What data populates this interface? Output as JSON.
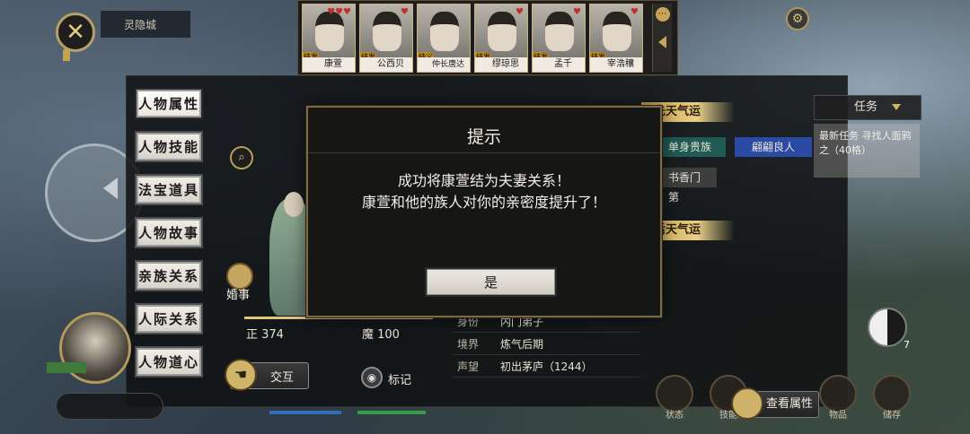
{
  "location": "灵隐城",
  "characters": [
    {
      "name": "康萱",
      "badge": "结发",
      "hearts": "♥♥♥"
    },
    {
      "name": "公西贝",
      "badge": "结发",
      "hearts": "♥"
    },
    {
      "name": "仲长唐达",
      "badge": "结义",
      "hearts": ""
    },
    {
      "name": "缪琼思",
      "badge": "结发",
      "hearts": "♥"
    },
    {
      "name": "孟千",
      "badge": "结发",
      "hearts": "♥"
    },
    {
      "name": "宰浩穰",
      "badge": "结发",
      "hearts": "♥"
    }
  ],
  "side_tabs": [
    "人物属性",
    "人物技能",
    "法宝道具",
    "人物故事",
    "亲族关系",
    "人际关系",
    "人物道心"
  ],
  "left": {
    "marriage_label": "婚事",
    "zheng_label": "正 374",
    "mo_label": "魔 100",
    "interact_label": "交互",
    "mark_label": "标记"
  },
  "info_rows": [
    {
      "key": "身份",
      "value": "内门弟子"
    },
    {
      "key": "境界",
      "value": "炼气后期"
    },
    {
      "key": "声望",
      "value": "初出茅庐（1244）"
    }
  ],
  "fortune": {
    "innate_title": "先天气运",
    "later_title": "后天气运",
    "tags": {
      "noble": "单身贵族",
      "good": "翩翩良人",
      "scholar": "书香门第"
    }
  },
  "task": {
    "header": "任务",
    "text": "最新任务 寻找人面鸦之（40格）"
  },
  "bottom": {
    "view_attr_label": "查看属性",
    "taiji_count": "7",
    "labels": [
      "状态",
      "技能",
      "物品",
      "储存"
    ]
  },
  "modal": {
    "title": "提示",
    "message_line1": "成功将康萱结为夫妻关系！",
    "message_line2": "康萱和他的族人对你的亲密度提升了！",
    "ok_label": "是"
  },
  "colors": {
    "gold": "#c9a24a",
    "tag_green": "#1f5a53",
    "tag_blue": "#2b4aa3"
  }
}
